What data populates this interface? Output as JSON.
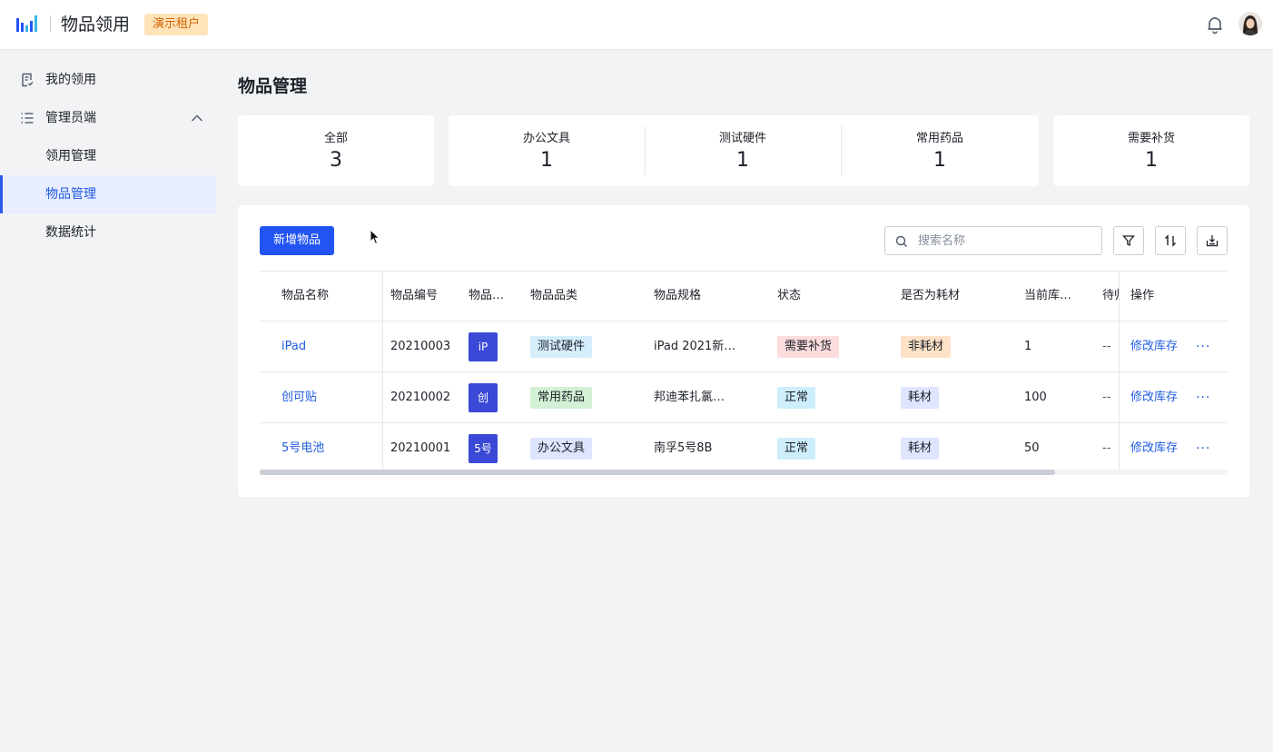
{
  "header": {
    "app_title": "物品领用",
    "tenant": "演示租户"
  },
  "sidebar": {
    "items": [
      {
        "label": "我的领用"
      },
      {
        "label": "管理员端"
      },
      {
        "label": "领用管理"
      },
      {
        "label": "物品管理"
      },
      {
        "label": "数据统计"
      }
    ],
    "active": "物品管理"
  },
  "main": {
    "title": "物品管理",
    "stats": [
      {
        "label": "全部",
        "value": "3"
      },
      {
        "label": "办公文具",
        "value": "1"
      },
      {
        "label": "测试硬件",
        "value": "1"
      },
      {
        "label": "常用药品",
        "value": "1"
      },
      {
        "label": "需要补货",
        "value": "1"
      }
    ],
    "add_button": "新增物品",
    "search_placeholder": "搜索名称",
    "table": {
      "columns": [
        "物品名称",
        "物品编号",
        "物品…",
        "物品品类",
        "物品规格",
        "状态",
        "是否为耗材",
        "当前库…",
        "待归",
        "操作"
      ],
      "rows": [
        {
          "name": "iPad",
          "code": "20210003",
          "thumb": "iP",
          "category": "测试硬件",
          "spec": "iPad 2021新…",
          "status": "需要补货",
          "consumable": "非耗材",
          "stock": "1",
          "pending": "--",
          "action": "修改库存",
          "more": "···"
        },
        {
          "name": "创可贴",
          "code": "20210002",
          "thumb": "创",
          "category": "常用药品",
          "spec": "邦迪苯扎氯…",
          "status": "正常",
          "consumable": "耗材",
          "stock": "100",
          "pending": "--",
          "action": "修改库存",
          "more": "···"
        },
        {
          "name": "5号电池",
          "code": "20210001",
          "thumb": "5号",
          "category": "办公文具",
          "spec": "南孚5号8B",
          "status": "正常",
          "consumable": "耗材",
          "stock": "50",
          "pending": "--",
          "action": "修改库存",
          "more": "···"
        }
      ]
    }
  },
  "colors": {
    "primary": "#2254f4",
    "link": "#1f5ce0",
    "tenant_bg": "#ffe4ba",
    "tenant_text": "#d25f00",
    "tag_hardware_bg": "#d6eefb",
    "tag_medicine_bg": "#d2f0d4",
    "tag_stationery_bg": "#dfe5ff",
    "status_restock_bg": "#fcdcdc",
    "status_normal_bg": "#cdeefb",
    "consumable_no_bg": "#fde2c7",
    "consumable_yes_bg": "#dfe5ff",
    "thumb_bg": "#3a49d6"
  },
  "icons": [
    "logo-icon",
    "bell-icon",
    "avatar",
    "doc-check-icon",
    "list-icon",
    "chevron-up-icon",
    "search-icon",
    "filter-icon",
    "sort-icon",
    "export-icon",
    "more-icon"
  ]
}
